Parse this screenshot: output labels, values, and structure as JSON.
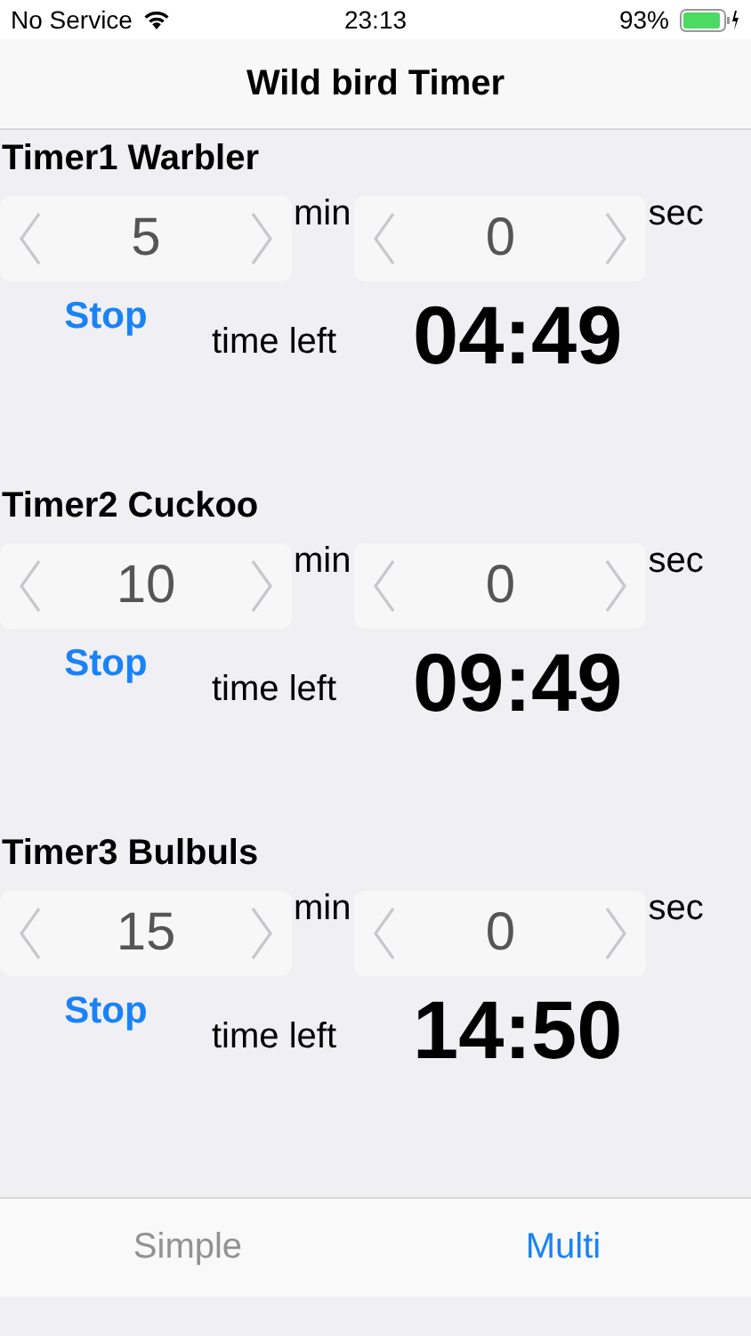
{
  "status_bar": {
    "carrier": "No Service",
    "time": "23:13",
    "battery": "93%"
  },
  "nav": {
    "title": "Wild bird Timer"
  },
  "timers": [
    {
      "title": "Timer1 Warbler",
      "minutes": "5",
      "min_label": "min",
      "seconds": "0",
      "sec_label": "sec",
      "button": "Stop",
      "left_label": "time left",
      "remaining": "04:49"
    },
    {
      "title": "Timer2 Cuckoo",
      "minutes": "10",
      "min_label": "min",
      "seconds": "0",
      "sec_label": "sec",
      "button": "Stop",
      "left_label": "time left",
      "remaining": "09:49"
    },
    {
      "title": "Timer3 Bulbuls",
      "minutes": "15",
      "min_label": "min",
      "seconds": "0",
      "sec_label": "sec",
      "button": "Stop",
      "left_label": "time left",
      "remaining": "14:50"
    }
  ],
  "tabs": [
    {
      "label": "Simple",
      "selected": false
    },
    {
      "label": "Multi",
      "selected": true
    }
  ]
}
